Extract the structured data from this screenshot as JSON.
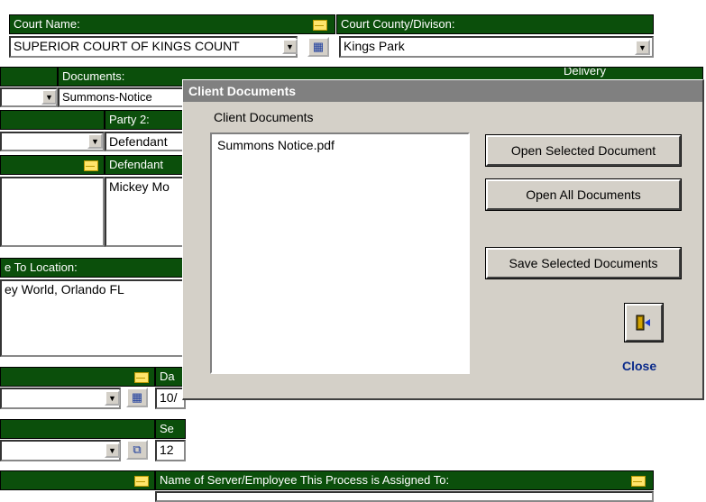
{
  "court_name": {
    "label": "Court Name:",
    "value": "SUPERIOR COURT OF KINGS COUNT"
  },
  "court_county": {
    "label": "Court County/Divison:",
    "value": "Kings Park"
  },
  "documents": {
    "label": "Documents:",
    "value": "Summons-Notice",
    "delivery_label": "Delivery"
  },
  "party2": {
    "label": "Party 2:",
    "value": "Defendant"
  },
  "defendant": {
    "label": "Defendant",
    "value": "Mickey Mo"
  },
  "location": {
    "label": "e To Location:",
    "value": "ey World, Orlando  FL"
  },
  "date": {
    "label": "Da",
    "value": "10/"
  },
  "service": {
    "label": "Se",
    "value": "12"
  },
  "server": {
    "label": "Name of Server/Employee This Process is Assigned To:"
  },
  "dialog": {
    "title": "Client Documents",
    "list_label": "Client Documents",
    "files": [
      "Summons Notice.pdf"
    ],
    "open_selected": "Open Selected Document",
    "open_all": "Open All Documents",
    "save_selected": "Save Selected Documents",
    "close_label": "Close"
  }
}
